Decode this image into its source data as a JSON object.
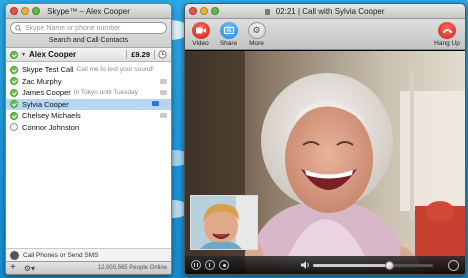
{
  "contacts_window": {
    "title": "Skype™ – Alex Cooper",
    "search": {
      "placeholder": "Skype Name or phone number",
      "button_label": "Search and Call Contacts"
    },
    "me": {
      "name": "Alex Cooper",
      "credit": "£9.29"
    },
    "contacts": [
      {
        "name": "Skype Test Call",
        "mood": "Call me to test your sound!",
        "status": "online",
        "selected": false
      },
      {
        "name": "Zac Murphy",
        "mood": "",
        "status": "online",
        "selected": false
      },
      {
        "name": "James Cooper",
        "mood": "In Tokyo until Tuesday",
        "status": "online",
        "selected": false
      },
      {
        "name": "Sylvia Cooper",
        "mood": "",
        "status": "online",
        "selected": true
      },
      {
        "name": "Chelsey Michaels",
        "mood": "",
        "status": "online",
        "selected": false
      },
      {
        "name": "Connor Johnston",
        "mood": "",
        "status": "offline",
        "selected": false
      }
    ],
    "phones_label": "Call Phones or Send SMS",
    "online_count": "12,000,565 People Online"
  },
  "call_window": {
    "title": "02:21 | Call with Sylvia Cooper",
    "toolbar": {
      "video_label": "Video",
      "share_label": "Share",
      "more_label": "More",
      "hangup_label": "Hang Up"
    },
    "volume_fraction": 0.63
  },
  "icons": {
    "video": "video-camera-icon",
    "share": "share-screen-icon",
    "more": "more-gear-icon",
    "hangup": "hang-up-phone-icon"
  },
  "colors": {
    "accent": "#1c94d8",
    "online": "#6cc04a",
    "hangup": "#c8231a"
  }
}
